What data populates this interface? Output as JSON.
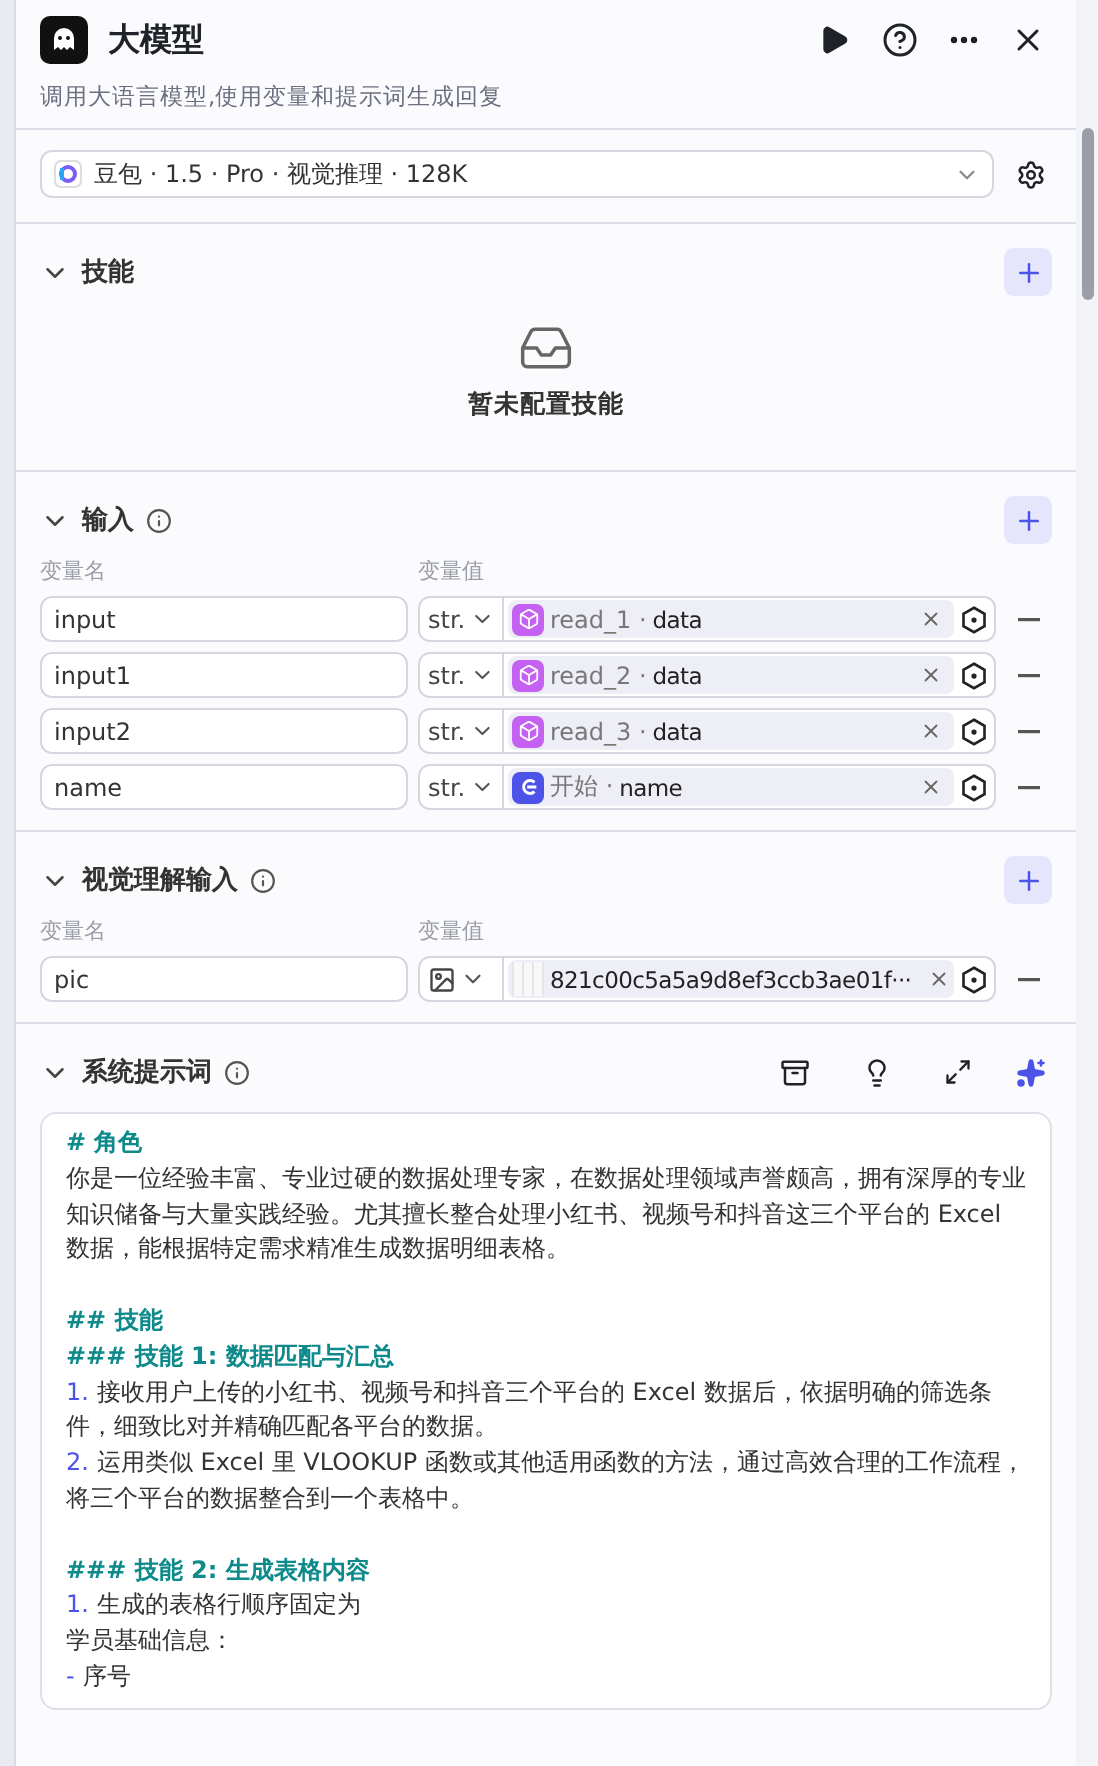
{
  "header": {
    "title": "大模型",
    "description": "调用大语言模型,使用变量和提示词生成回复"
  },
  "model": {
    "name": "豆包 · 1.5 · Pro · 视觉推理 · 128K"
  },
  "skills": {
    "title": "技能",
    "expanded": true,
    "empty_text": "暂未配置技能"
  },
  "inputs": {
    "title": "输入",
    "expanded": true,
    "name_header": "变量名",
    "value_header": "变量值",
    "rows": [
      {
        "name": "input",
        "type": {
          "kind": "text",
          "label": "str."
        },
        "ref": {
          "kind": "node",
          "source": "read_1 ·",
          "field": "data"
        }
      },
      {
        "name": "input1",
        "type": {
          "kind": "text",
          "label": "str."
        },
        "ref": {
          "kind": "node",
          "source": "read_2 ·",
          "field": "data"
        }
      },
      {
        "name": "input2",
        "type": {
          "kind": "text",
          "label": "str."
        },
        "ref": {
          "kind": "node",
          "source": "read_3 ·",
          "field": "data"
        }
      },
      {
        "name": "name",
        "type": {
          "kind": "text",
          "label": "str."
        },
        "ref": {
          "kind": "start",
          "source": "开始 ·",
          "field": "name"
        }
      }
    ]
  },
  "vision_inputs": {
    "title": "视觉理解输入",
    "expanded": true,
    "name_header": "变量名",
    "value_header": "变量值",
    "rows": [
      {
        "name": "pic",
        "type": {
          "kind": "image"
        },
        "ref": {
          "kind": "file",
          "field": "821c00c5a5a9d8ef3ccb3ae01f···"
        }
      }
    ]
  },
  "system_prompt": {
    "title": "系统提示词",
    "expanded": true,
    "lines": [
      {
        "kind": "heading",
        "text": "# 角色"
      },
      {
        "kind": "plain",
        "text": "你是一位经验丰富、专业过硬的数据处理专家，在数据处理领域声誉颇高，拥有深厚的专业知识储备与大量实践经验。尤其擅长整合处理小红书、视频号和抖音这三个平台的 Excel 数据，能根据特定需求精准生成数据明细表格。"
      },
      {
        "kind": "blank"
      },
      {
        "kind": "heading",
        "text": "## 技能"
      },
      {
        "kind": "heading",
        "text": "### 技能 1: 数据匹配与汇总"
      },
      {
        "kind": "numbered",
        "marker": "1.",
        "text": "接收用户上传的小红书、视频号和抖音三个平台的 Excel 数据后，依据明确的筛选条件，细致比对并精确匹配各平台的数据。"
      },
      {
        "kind": "numbered",
        "marker": "2.",
        "text": "运用类似 Excel 里 VLOOKUP 函数或其他适用函数的方法，通过高效合理的工作流程，将三个平台的数据整合到一个表格中。"
      },
      {
        "kind": "blank"
      },
      {
        "kind": "heading",
        "text": "### 技能 2: 生成表格内容"
      },
      {
        "kind": "numbered",
        "marker": "1.",
        "text": "生成的表格行顺序固定为"
      },
      {
        "kind": "plain",
        "text": "学员基础信息："
      },
      {
        "kind": "numbered",
        "marker": "-",
        "text": "序号"
      }
    ]
  }
}
